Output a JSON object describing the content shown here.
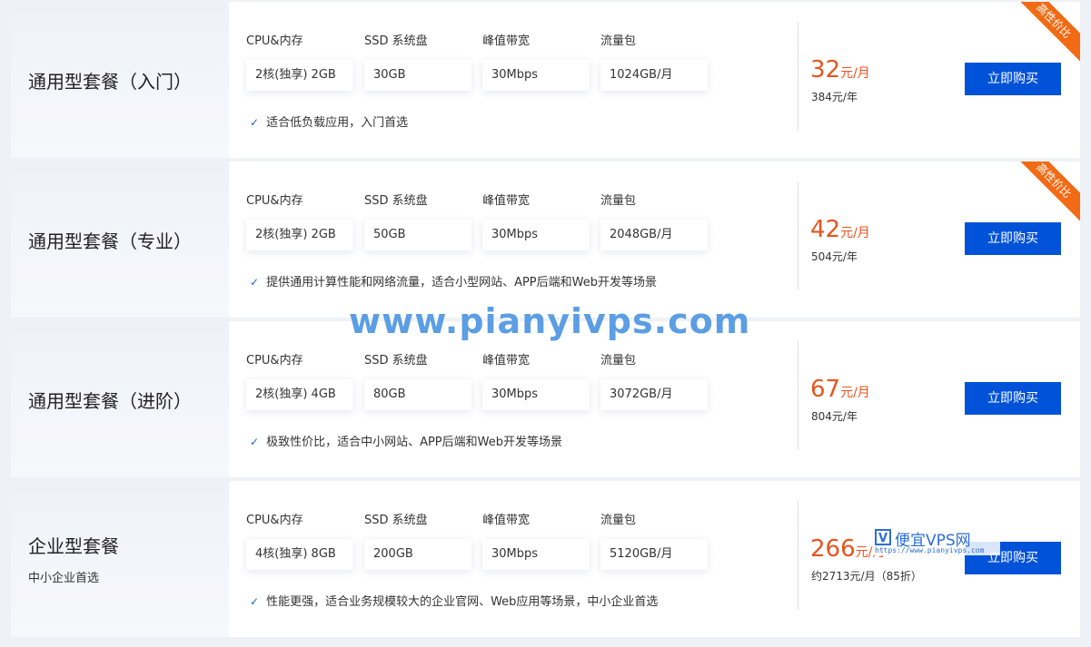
{
  "spec_headers": [
    "CPU&内存",
    "SSD 系统盘",
    "峰值带宽",
    "流量包"
  ],
  "buy_label": "立即购买",
  "badge_label": "高性价比",
  "plans": [
    {
      "name": "通用型套餐（入门）",
      "specs": [
        "2核(独享) 2GB",
        "30GB",
        "30Mbps",
        "1024GB/月"
      ],
      "feature": "适合低负载应用，入门首选",
      "price": "32",
      "price_unit": "元/月",
      "yearly": "384元/年",
      "badge": true
    },
    {
      "name": "通用型套餐（专业）",
      "specs": [
        "2核(独享) 2GB",
        "50GB",
        "30Mbps",
        "2048GB/月"
      ],
      "feature": "提供通用计算性能和网络流量，适合小型网站、APP后端和Web开发等场景",
      "price": "42",
      "price_unit": "元/月",
      "yearly": "504元/年",
      "badge": true
    },
    {
      "name": "通用型套餐（进阶）",
      "specs": [
        "2核(独享) 4GB",
        "80GB",
        "30Mbps",
        "3072GB/月"
      ],
      "feature": "极致性价比，适合中小网站、APP后端和Web开发等场景",
      "price": "67",
      "price_unit": "元/月",
      "yearly": "804元/年",
      "badge": false
    },
    {
      "name": "企业型套餐",
      "subtitle": "中小企业首选",
      "specs": [
        "4核(独享) 8GB",
        "200GB",
        "30Mbps",
        "5120GB/月"
      ],
      "feature": "性能更强，适合业务规模较大的企业官网、Web应用等场景，中小企业首选",
      "price": "266",
      "price_unit": "元/月",
      "yearly": "约2713元/月（85折）",
      "badge": false
    }
  ],
  "watermark": {
    "main": "www.pianyivps.com",
    "logo_letter": "V",
    "brand": "便宜VPS网",
    "url": "https://www.pianyivps.com"
  }
}
